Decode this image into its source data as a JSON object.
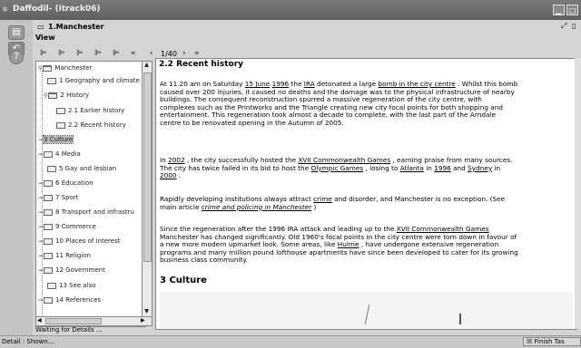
{
  "window": {
    "title": "Daffodil- (itrack06)"
  },
  "tab": {
    "label": "1.Manchester"
  },
  "menu": {
    "view": "View"
  },
  "toolbar": {
    "page": "1/40"
  },
  "tree": {
    "items": [
      {
        "label": "Manchester"
      },
      {
        "label": "1 Geography and climate"
      },
      {
        "label": "2 History"
      },
      {
        "label": "2.1 Earlier history"
      },
      {
        "label": "2.2 Recent history"
      },
      {
        "label": "3 Culture"
      },
      {
        "label": "4 Media"
      },
      {
        "label": "5 Gay and lesbian"
      },
      {
        "label": "6 Education"
      },
      {
        "label": "7 Sport"
      },
      {
        "label": "8 Transport and infrastru"
      },
      {
        "label": "9 Commerce"
      },
      {
        "label": "10 Places of interest"
      },
      {
        "label": "11 Religion"
      },
      {
        "label": "12 Government"
      },
      {
        "label": "13 See also"
      },
      {
        "label": "14 References"
      }
    ]
  },
  "status": {
    "waiting": "Waiting for Details ...",
    "detail": "Detail : Shown...",
    "finish": "Finish Tas"
  },
  "content": {
    "heading": "2.2 Recent history",
    "p1": {
      "t1": "At 11.20 am on Saturday ",
      "l1": "15 June",
      "t2": " ",
      "l2": "1996",
      "t3": " the ",
      "l3": "IRA",
      "t4": " detonated a large ",
      "l4": "bomb in the city centre",
      "t5": " . Whilst this bomb caused over 200 injuries, it caused no deaths and the damage was to the physical infrastructure of nearby buildings. The consequent reconstruction spurred a massive regeneration of the city centre, with complexes such as the Printworks and the Triangle creating new city focal points for both shopping and entertainment. This regeneration took almost a decade to complete, with the last part of the Arndale centre to be renovated opening in the Autumn of 2005."
    },
    "p2": {
      "t1": "In ",
      "l1": "2002",
      "t2": " , the city successfully hosted the ",
      "l2": "XVII Commonwealth Games",
      "t3": " , earning praise from many sources. The city has twice failed in its bid to host the ",
      "l3": "Olympic Games",
      "t4": " , losing to ",
      "l4": "Atlanta",
      "t5": " in ",
      "l5": "1996",
      "t6": " and ",
      "l6": "Sydney",
      "t7": " in ",
      "l7": "2000",
      "t8": " ."
    },
    "p3": {
      "t1": "Rapidly developing institutions always attract ",
      "l1": "crime",
      "t2": " and disorder, and Manchester is no exception. (See main article ",
      "l2": "crime and policing in Manchester",
      "t3": " )"
    },
    "p4": {
      "t1": "Since the regeneration after the 1996 IRA attack and leading up to the ",
      "l1": "XVII Commonwealth Games",
      "t2": " Manchester has changed significantly. Old 1960's focal points in the city centre were torn down in favour of a new more modern upmarket look. Some areas, like ",
      "l2": "Hulme",
      "t3": " , have undergone extensive regeneration programs and many million pound lofthouse apartments have since been developed to cater for its growing business class community."
    },
    "heading3": "3 Culture"
  }
}
